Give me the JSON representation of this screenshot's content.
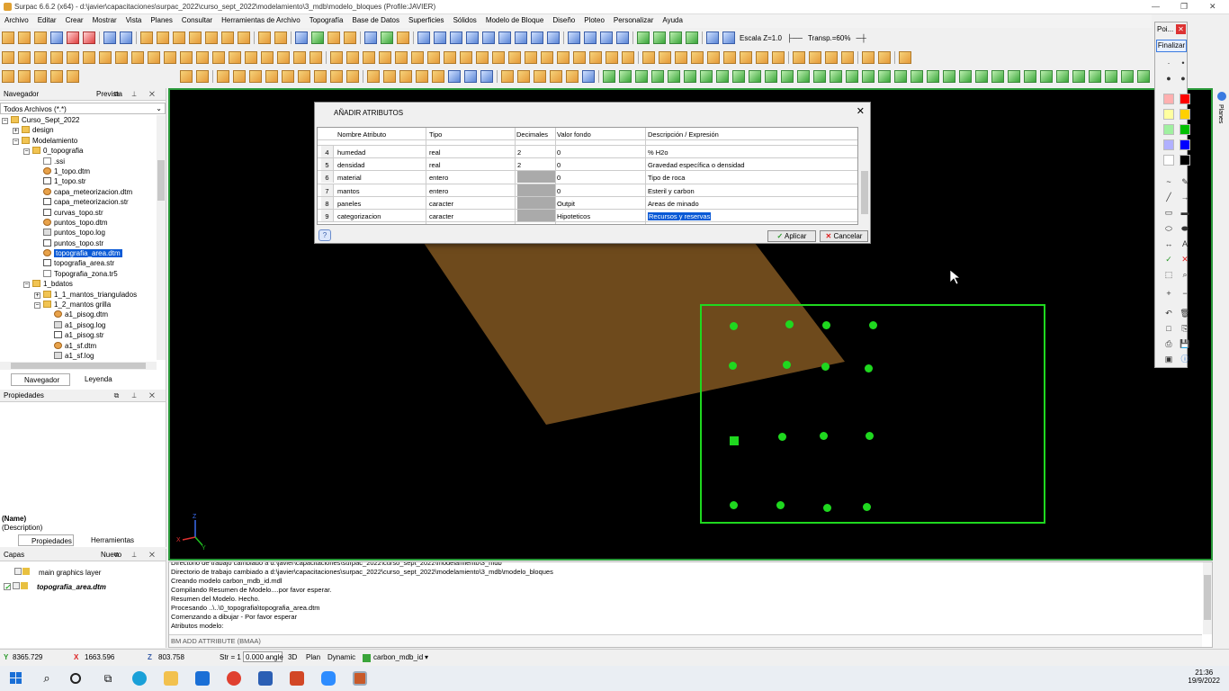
{
  "window": {
    "title": "Surpac 6.6.2 (x64) - d:\\javier\\capacitaciones\\surpac_2022\\curso_sept_2022\\modelamiento\\3_mdb\\modelo_bloques (Profile:JAVIER)"
  },
  "menu": [
    "Archivo",
    "Editar",
    "Crear",
    "Mostrar",
    "Vista",
    "Planes",
    "Consultar",
    "Herramientas de Archivo",
    "Topografía",
    "Base de Datos",
    "Superficies",
    "Sólidos",
    "Modelo de Bloque",
    "Diseño",
    "Ploteo",
    "Personalizar",
    "Ayuda"
  ],
  "toolbar": {
    "scale_label": "Escala Z=1.0",
    "transp_label": "Transp.=60%"
  },
  "navigator": {
    "title": "Navegador",
    "tab_preview": "Prevista",
    "filter": "Todos Archivos (*.*)",
    "items": [
      {
        "label": "Curso_Sept_2022",
        "type": "folder",
        "level": 0,
        "exp": "-"
      },
      {
        "label": "design",
        "type": "folder",
        "level": 1,
        "exp": "+"
      },
      {
        "label": "Modelamiento",
        "type": "folder",
        "level": 1,
        "exp": "-"
      },
      {
        "label": "0_topografia",
        "type": "folder",
        "level": 2,
        "exp": "-"
      },
      {
        "label": ".ssi",
        "type": "file",
        "level": 3,
        "exp": ""
      },
      {
        "label": "1_topo.dtm",
        "type": "dtm",
        "level": 3,
        "exp": ""
      },
      {
        "label": "1_topo.str",
        "type": "str",
        "level": 3,
        "exp": ""
      },
      {
        "label": "capa_meteorizacion.dtm",
        "type": "dtm",
        "level": 3,
        "exp": ""
      },
      {
        "label": "capa_meteorizacion.str",
        "type": "str",
        "level": 3,
        "exp": ""
      },
      {
        "label": "curvas_topo.str",
        "type": "str",
        "level": 3,
        "exp": ""
      },
      {
        "label": "puntos_topo.dtm",
        "type": "dtm",
        "level": 3,
        "exp": ""
      },
      {
        "label": "puntos_topo.log",
        "type": "log",
        "level": 3,
        "exp": ""
      },
      {
        "label": "puntos_topo.str",
        "type": "str",
        "level": 3,
        "exp": ""
      },
      {
        "label": "topografia_area.dtm",
        "type": "dtm",
        "level": 3,
        "exp": "",
        "selected": true
      },
      {
        "label": "topografia_area.str",
        "type": "str",
        "level": 3,
        "exp": ""
      },
      {
        "label": "Topografia_zona.tr5",
        "type": "file",
        "level": 3,
        "exp": ""
      },
      {
        "label": "1_bdatos",
        "type": "folder",
        "level": 2,
        "exp": "-"
      },
      {
        "label": "1_1_mantos_triangulados",
        "type": "folder",
        "level": 3,
        "exp": "+"
      },
      {
        "label": "1_2_mantos grilla",
        "type": "folder",
        "level": 3,
        "exp": "-"
      },
      {
        "label": "a1_pisog.dtm",
        "type": "dtm",
        "level": 4,
        "exp": ""
      },
      {
        "label": "a1_pisog.log",
        "type": "log",
        "level": 4,
        "exp": ""
      },
      {
        "label": "a1_pisog.str",
        "type": "str",
        "level": 4,
        "exp": ""
      },
      {
        "label": "a1_sf.dtm",
        "type": "dtm",
        "level": 4,
        "exp": ""
      },
      {
        "label": "a1_sf.log",
        "type": "log",
        "level": 4,
        "exp": ""
      }
    ],
    "tabs": [
      "Navegador",
      "Leyenda"
    ]
  },
  "properties": {
    "title": "Propiedades",
    "name": "(Name)",
    "description": "(Description)",
    "tabs": [
      "Propiedades",
      "Herramientas"
    ]
  },
  "layers": {
    "title": "Capas",
    "new_label": "Nuevo",
    "items": [
      "main graphics layer",
      "topografia_area.dtm"
    ]
  },
  "dialog": {
    "title": "AÑADIR ATRIBUTOS",
    "columns": [
      "Nombre Atributo",
      "Tipo",
      "Decimales",
      "Valor fondo",
      "Descripción / Expresión"
    ],
    "rows": [
      {
        "n": "4",
        "name": "humedad",
        "type": "real",
        "dec": "2",
        "bg": "0",
        "desc": "% H2o"
      },
      {
        "n": "5",
        "name": "densidad",
        "type": "real",
        "dec": "2",
        "bg": "0",
        "desc": "Gravedad específica o densidad"
      },
      {
        "n": "6",
        "name": "material",
        "type": "entero",
        "dec": "",
        "bg": "0",
        "desc": "Tipo de roca"
      },
      {
        "n": "7",
        "name": "mantos",
        "type": "entero",
        "dec": "",
        "bg": "0",
        "desc": "Esteril y carbon"
      },
      {
        "n": "8",
        "name": "paneles",
        "type": "caracter",
        "dec": "",
        "bg": "Outpit",
        "desc": "Areas de minado"
      },
      {
        "n": "9",
        "name": "categorizacion",
        "type": "caracter",
        "dec": "",
        "bg": "Hipoteticos",
        "desc": "Recursos y reservas"
      }
    ],
    "apply_label": "Aplicar",
    "cancel_label": "Cancelar"
  },
  "console": {
    "lines": [
      "Directorio de trabajo cambiado a d:\\javier\\capacitaciones\\surpac_2022\\curso_sept_2022\\modelamiento\\3_mdb",
      "Directorio de trabajo cambiado a d:\\javier\\capacitaciones\\surpac_2022\\curso_sept_2022\\modelamiento\\3_mdb\\modelo_bloques",
      "Creando modelo carbon_mdb_id.mdl",
      "Compilando Resumen de Modelo....por favor esperar.",
      "Resumen del Modelo. Hecho.",
      "Procesando ..\\..\\0_topografia\\topografia_area.dtm",
      "Comenzando a dibujar - Por favor esperar",
      "Atributos modelo:"
    ],
    "command": "BM ADD ATTRIBUTE (BMAA)"
  },
  "status": {
    "y": "8365.729",
    "x": "1663.596",
    "z": "803.758",
    "str_label": "Str = 1",
    "angle": "0.000 angle",
    "mode3d": "3D",
    "plan": "Plan",
    "dynamic": "Dynamic",
    "model": "carbon_mdb_id"
  },
  "palette": {
    "title": "Poi...",
    "finish_label": "Finalizar"
  },
  "right_tab": "Planes",
  "taskbar": {
    "time": "21:36",
    "date": "19/9/2022"
  }
}
